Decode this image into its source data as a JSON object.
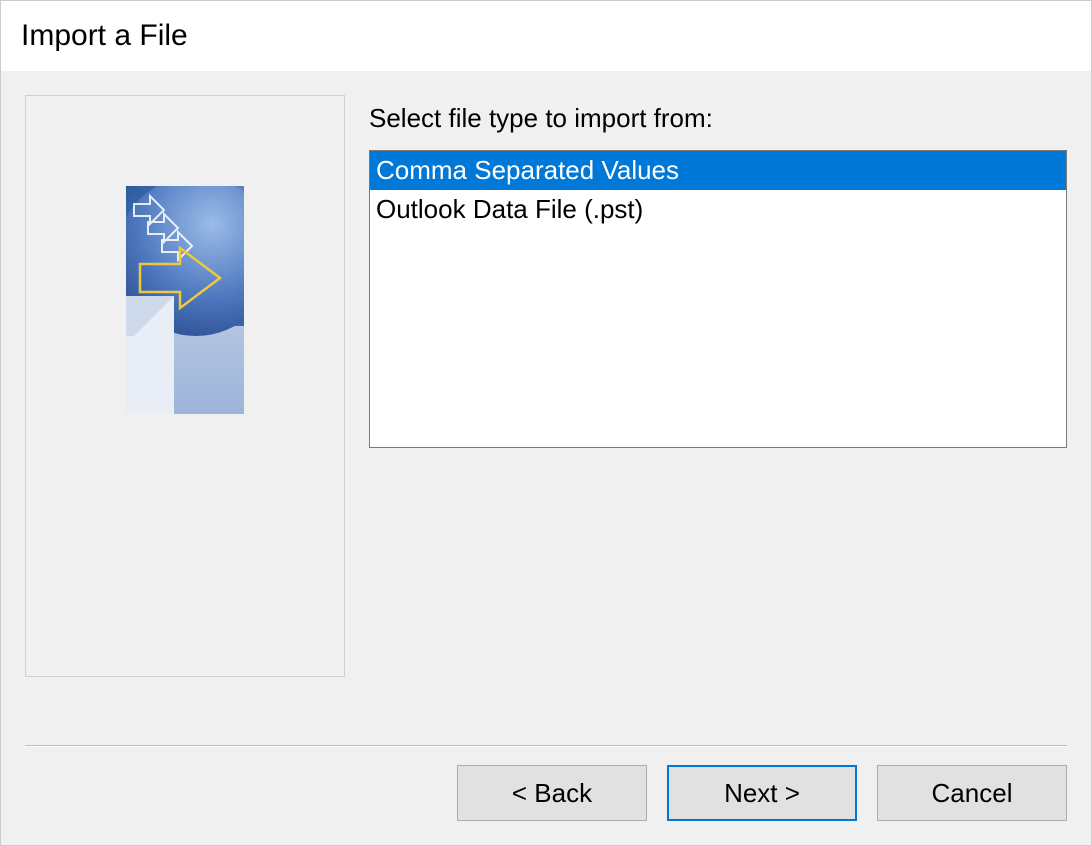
{
  "window": {
    "title": "Import a File"
  },
  "content": {
    "instruction": "Select file type to import from:",
    "options": [
      {
        "label": "Comma Separated Values",
        "selected": true
      },
      {
        "label": "Outlook Data File (.pst)",
        "selected": false
      }
    ]
  },
  "buttons": {
    "back": "< Back",
    "next": "Next >",
    "cancel": "Cancel"
  }
}
